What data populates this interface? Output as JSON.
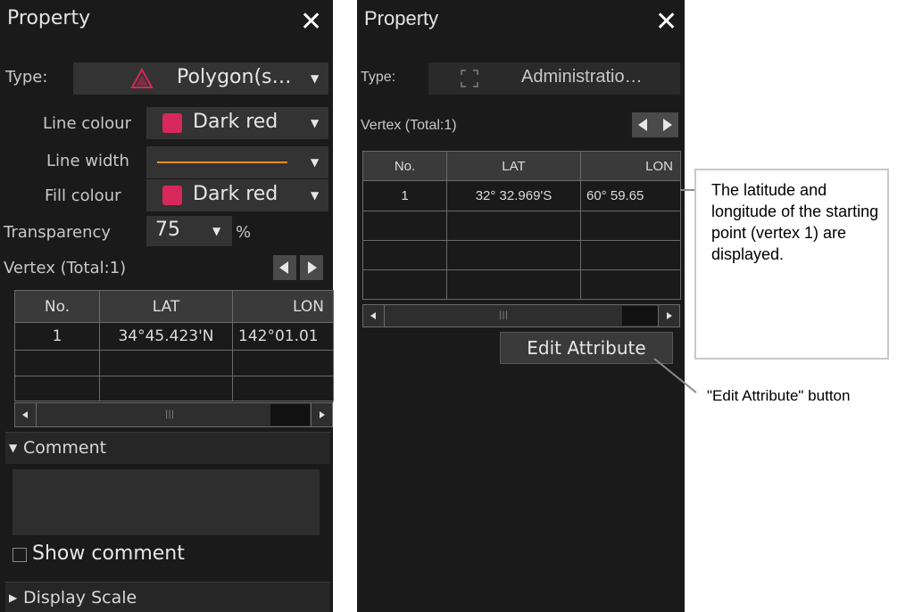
{
  "left_panel": {
    "title": "Property",
    "type_label": "Type:",
    "type_value": "Polygon(s…",
    "line_colour_label": "Line colour",
    "line_colour_value": "Dark red",
    "line_width_label": "Line width",
    "fill_colour_label": "Fill colour",
    "fill_colour_value": "Dark red",
    "transparency_label": "Transparency",
    "transparency_value": "75",
    "transparency_unit": "%",
    "vertex_label": "Vertex (Total:1)",
    "table": {
      "headers": [
        "No.",
        "LAT",
        "LON"
      ],
      "rows": [
        [
          "1",
          "34°45.423'N",
          "142°01.01"
        ]
      ]
    },
    "comment_label": "Comment",
    "show_comment_label": "Show comment",
    "show_comment_checked": false,
    "display_scale_label": "Display Scale"
  },
  "right_panel": {
    "title": "Property",
    "type_label": "Type:",
    "type_value": "Administratio…",
    "vertex_label": "Vertex (Total:1)",
    "table": {
      "headers": [
        "No.",
        "LAT",
        "LON"
      ],
      "rows": [
        [
          "1",
          "32° 32.969'S",
          "60° 59.65"
        ]
      ]
    },
    "edit_attribute_label": "Edit Attribute"
  },
  "annotations": {
    "latlon_callout": "The latitude and longitude of the starting point (vertex 1) are displayed.",
    "edit_button_callout": "\"Edit Attribute\" button"
  },
  "colors": {
    "swatch": "#d6285a",
    "line_width_sample": "#ff8c1a",
    "panel_bg": "#1a1a1a"
  },
  "icons": {
    "polygon_type": "polygon-icon",
    "administration_type": "administration-area-icon"
  }
}
